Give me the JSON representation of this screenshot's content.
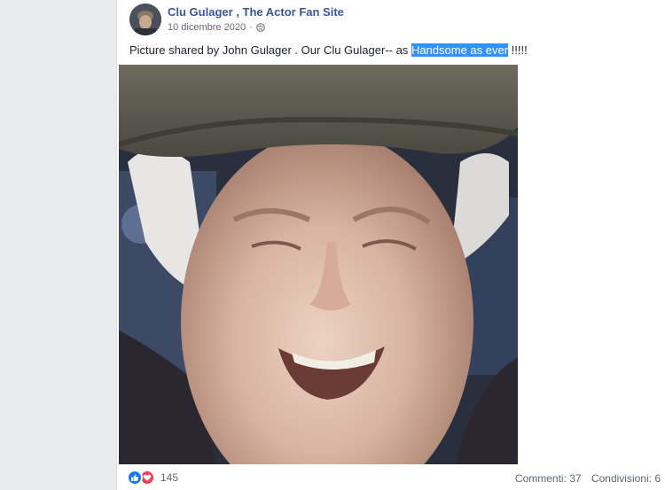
{
  "post": {
    "page_name": "Clu Gulager , The Actor Fan Site",
    "date": "10 dicembre 2020",
    "separator": "·",
    "audience_icon": "globe-icon",
    "caption_before": "Picture shared by John Gulager . Our Clu Gulager-- as ",
    "caption_highlight": "Handsome as ever",
    "caption_after": " !!!!!"
  },
  "footer": {
    "reaction_icons": [
      "like-icon",
      "love-icon"
    ],
    "reaction_count": "145",
    "comments": "Commenti: 37",
    "shares": "Condivisioni: 6"
  },
  "colors": {
    "page_name": "#385898",
    "highlight": "#3390ff",
    "like": "#1877f2",
    "love": "#f33e58"
  }
}
